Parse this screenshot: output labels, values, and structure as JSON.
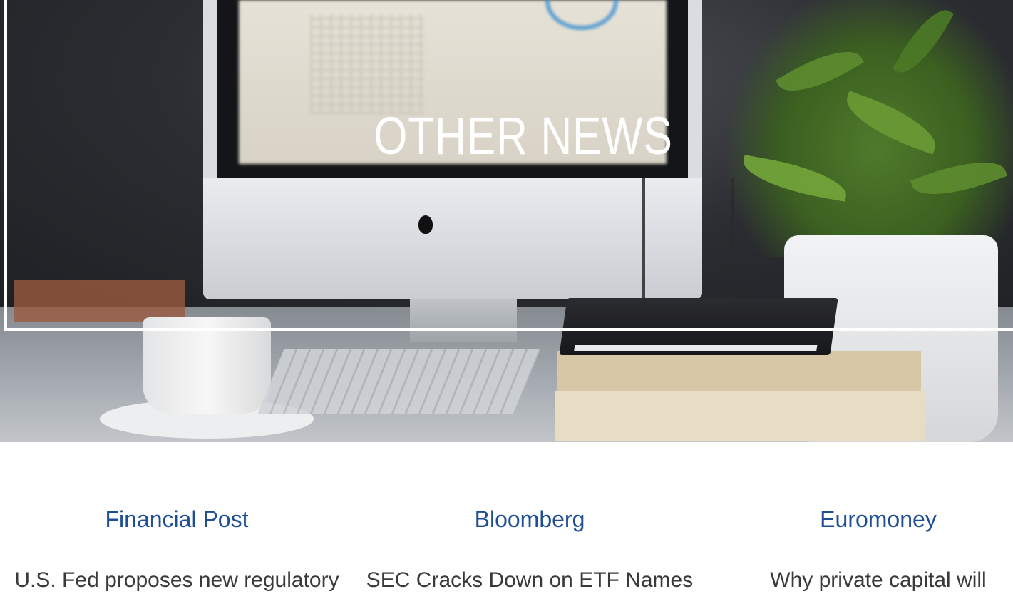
{
  "hero": {
    "title": "OTHER NEWS"
  },
  "news": {
    "items": [
      {
        "source": "Financial Post",
        "headline": "U.S. Fed proposes new regulatory"
      },
      {
        "source": "Bloomberg",
        "headline": "SEC Cracks Down on ETF Names"
      },
      {
        "source": "Euromoney",
        "headline": "Why private capital will"
      }
    ]
  },
  "colors": {
    "source_link": "#1e4f94",
    "headline_text": "#3a3a3a",
    "hero_title": "#ffffff"
  }
}
